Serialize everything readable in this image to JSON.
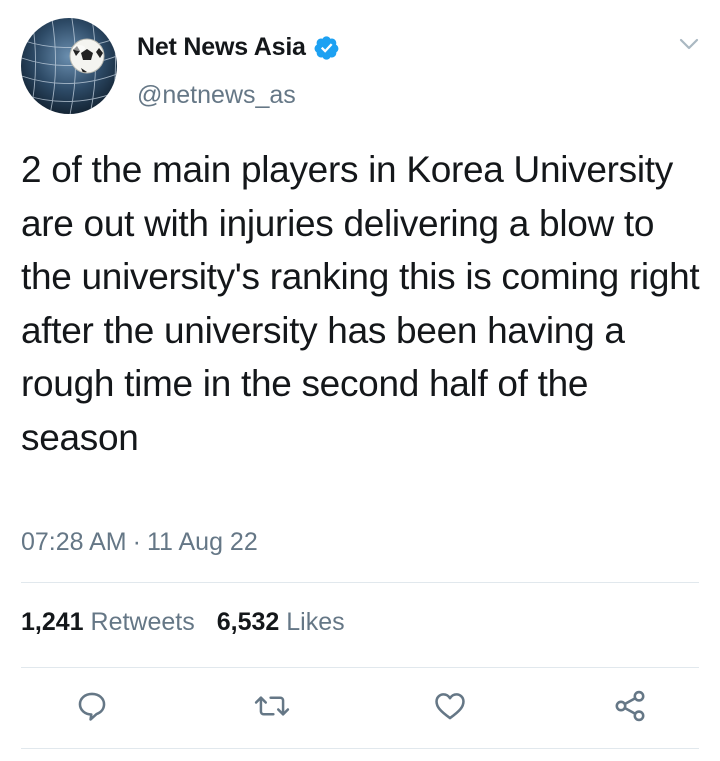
{
  "author": {
    "display_name": "Net News Asia",
    "handle": "@netnews_as",
    "verified": true,
    "avatar_icon": "soccer-ball-net-icon"
  },
  "tweet": {
    "text": "2 of the main players in Korea University are out with injuries delivering a blow to the university's ranking this is coming right after the university has been having a rough time in the second half of the season",
    "time": "07:28 AM",
    "separator": "·",
    "date": "11 Aug 22"
  },
  "stats": {
    "retweets_count": "1,241",
    "retweets_label": "Retweets",
    "likes_count": "6,532",
    "likes_label": "Likes"
  },
  "actions": {
    "reply_icon": "reply-icon",
    "retweet_icon": "retweet-icon",
    "like_icon": "heart-icon",
    "share_icon": "share-icon"
  },
  "colors": {
    "primary_text": "#14171a",
    "secondary_text": "#657786",
    "verified_blue": "#1da1f2",
    "divider": "#e1e8ed"
  }
}
